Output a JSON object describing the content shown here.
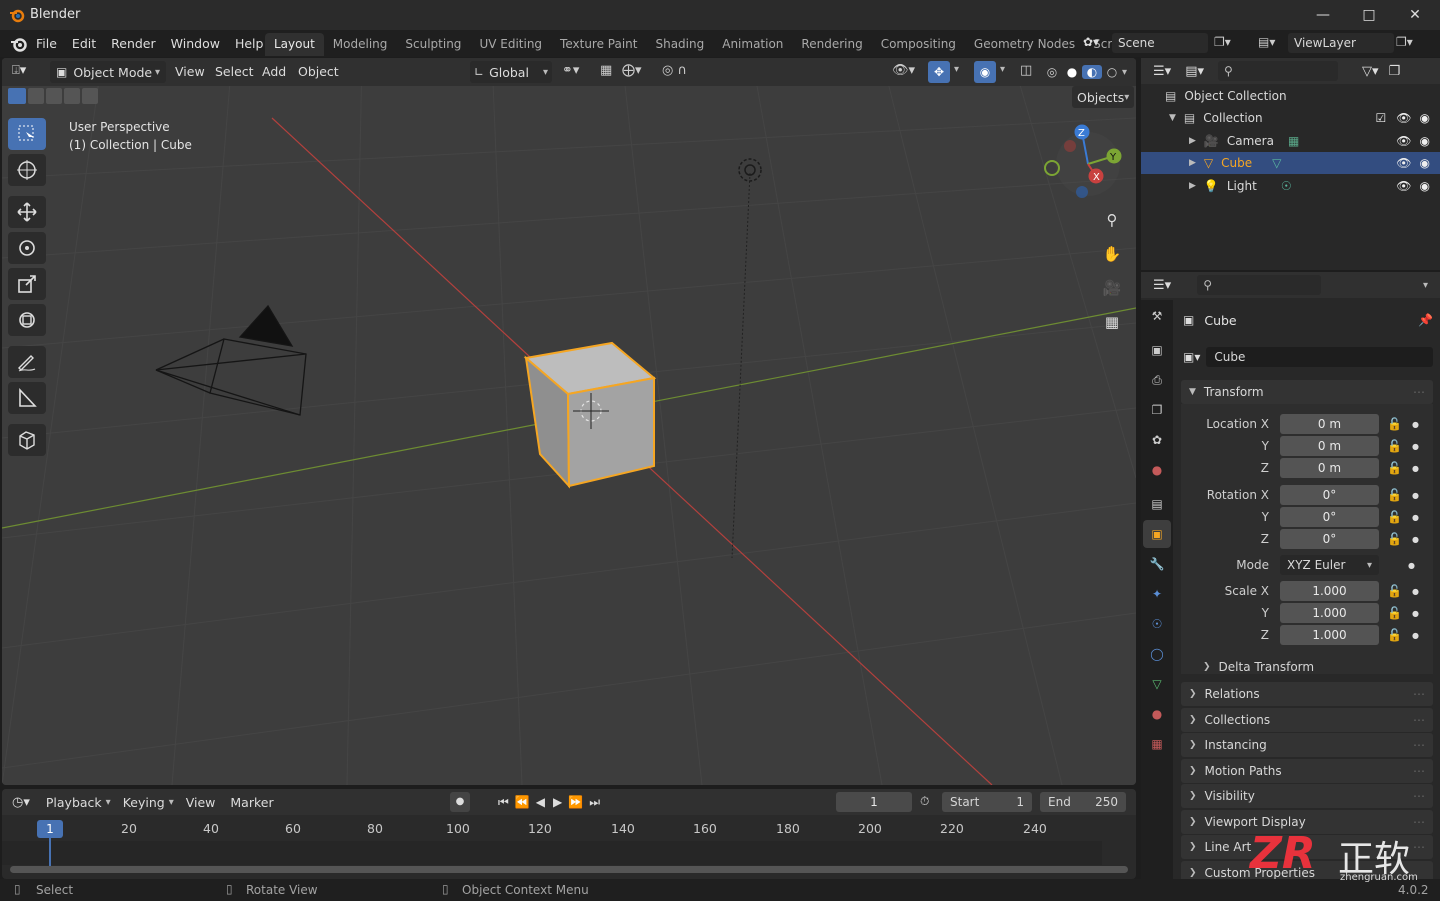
{
  "app": {
    "title": "Blender"
  },
  "menu": [
    "File",
    "Edit",
    "Render",
    "Window",
    "Help"
  ],
  "workspaces": [
    "Layout",
    "Modeling",
    "Sculpting",
    "UV Editing",
    "Texture Paint",
    "Shading",
    "Animation",
    "Rendering",
    "Compositing",
    "Geometry Nodes",
    "Scripting"
  ],
  "scene": {
    "scene_name": "Scene",
    "view_layer": "ViewLayer"
  },
  "viewport": {
    "mode": "Object Mode",
    "menus": [
      "View",
      "Select",
      "Add",
      "Object"
    ],
    "orientation": "Global",
    "info_line1": "User Perspective",
    "info_line2": "(1) Collection | Cube",
    "objects_dropdown": "Objects",
    "gizmo": {
      "x": "X",
      "y": "Y",
      "z": "Z"
    }
  },
  "outliner": {
    "root": "Object Collection",
    "collection": "Collection",
    "items": [
      {
        "name": "Camera",
        "selected": false
      },
      {
        "name": "Cube",
        "selected": true
      },
      {
        "name": "Light",
        "selected": false
      }
    ]
  },
  "properties": {
    "object_name": "Cube",
    "datablock": "Cube",
    "transform_title": "Transform",
    "location": {
      "label": "Location X",
      "x": "0 m",
      "y": "0 m",
      "z": "0 m"
    },
    "rotation": {
      "label": "Rotation X",
      "x": "0°",
      "y": "0°",
      "z": "0°"
    },
    "mode": {
      "label": "Mode",
      "value": "XYZ Euler"
    },
    "scale": {
      "label": "Scale X",
      "x": "1.000",
      "y": "1.000",
      "z": "1.000"
    },
    "axis_y": "Y",
    "axis_z": "Z",
    "delta": "Delta Transform",
    "panels": [
      "Relations",
      "Collections",
      "Instancing",
      "Motion Paths",
      "Visibility",
      "Viewport Display",
      "Line Art",
      "Custom Properties"
    ]
  },
  "timeline": {
    "menus": [
      "Playback",
      "Keying",
      "View",
      "Marker"
    ],
    "current_frame": "1",
    "start_label": "Start",
    "start": "1",
    "end_label": "End",
    "end": "250",
    "ticks": [
      "20",
      "40",
      "60",
      "80",
      "100",
      "120",
      "140",
      "160",
      "180",
      "200",
      "220",
      "240"
    ],
    "playhead": "1"
  },
  "status": {
    "left": "Select",
    "middle": "Rotate View",
    "right": "Object Context Menu",
    "version": "4.0.2"
  },
  "watermark": {
    "brand": "ZR",
    "chinese": "正软",
    "url": "zhengruan.com"
  },
  "colors": {
    "accent": "#4772b3",
    "selection_outline": "#f5a623",
    "x_axis": "#c8413f",
    "y_axis": "#7ca534",
    "z_axis": "#3a7bd5"
  }
}
